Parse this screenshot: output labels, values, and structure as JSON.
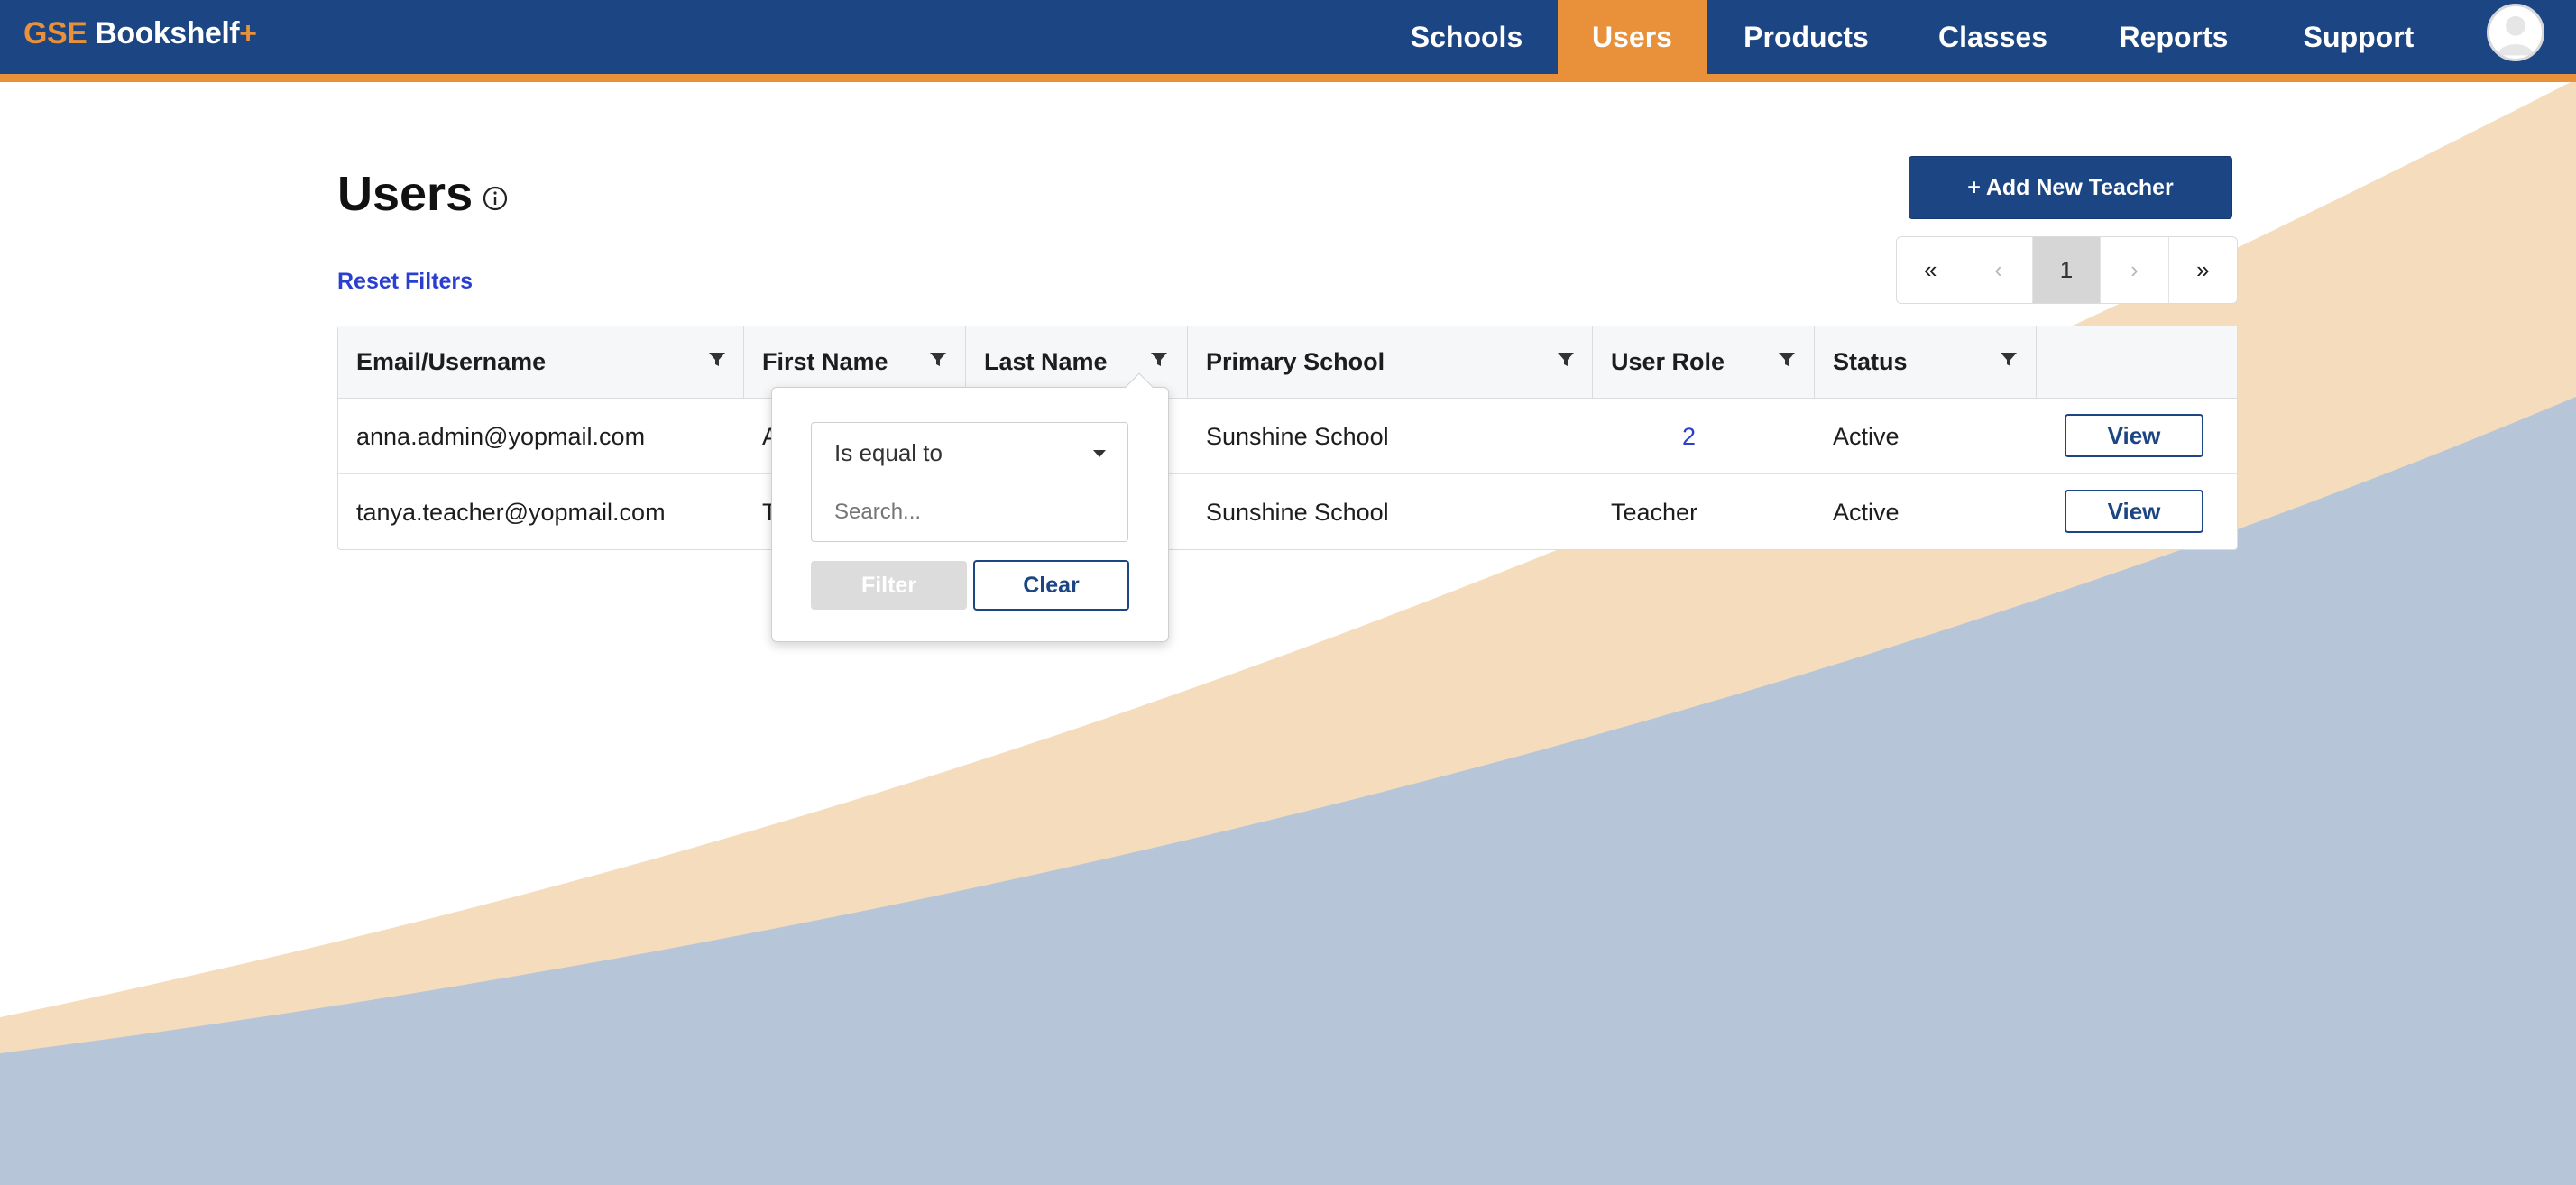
{
  "header": {
    "logo": {
      "part1": "GSE",
      "part2": " Bookshelf",
      "part3": "+"
    },
    "nav": [
      {
        "label": "Schools",
        "active": false
      },
      {
        "label": "Users",
        "active": true
      },
      {
        "label": "Products",
        "active": false
      },
      {
        "label": "Classes",
        "active": false
      },
      {
        "label": "Reports",
        "active": false
      },
      {
        "label": "Support",
        "active": false
      }
    ],
    "avatar_icon": "user-avatar-icon"
  },
  "page": {
    "title": "Users",
    "info_icon": "info-icon",
    "reset_filters": "Reset Filters",
    "add_button": "+ Add New Teacher"
  },
  "pagination": {
    "first": "«",
    "prev": "‹",
    "current": "1",
    "next": "›",
    "last": "»"
  },
  "table": {
    "columns": [
      "Email/Username",
      "First Name",
      "Last Name",
      "Primary School",
      "User Role",
      "Status",
      ""
    ],
    "rows": [
      {
        "email": "anna.admin@yopmail.com",
        "first": "A",
        "school": "Sunshine School",
        "role": "2",
        "status": "Active",
        "action": "View"
      },
      {
        "email": "tanya.teacher@yopmail.com",
        "first": "T",
        "school": "Sunshine School",
        "role": "Teacher",
        "status": "Active",
        "action": "View"
      }
    ]
  },
  "filter_popup": {
    "operator": "Is equal to",
    "search_placeholder": "Search...",
    "filter_label": "Filter",
    "clear_label": "Clear"
  },
  "colors": {
    "brand_blue": "#1b4583",
    "accent_orange": "#e8913a",
    "link_blue": "#2a3fd1",
    "bg_peach": "#f4dcbd",
    "bg_slate": "#b6c6d8"
  }
}
